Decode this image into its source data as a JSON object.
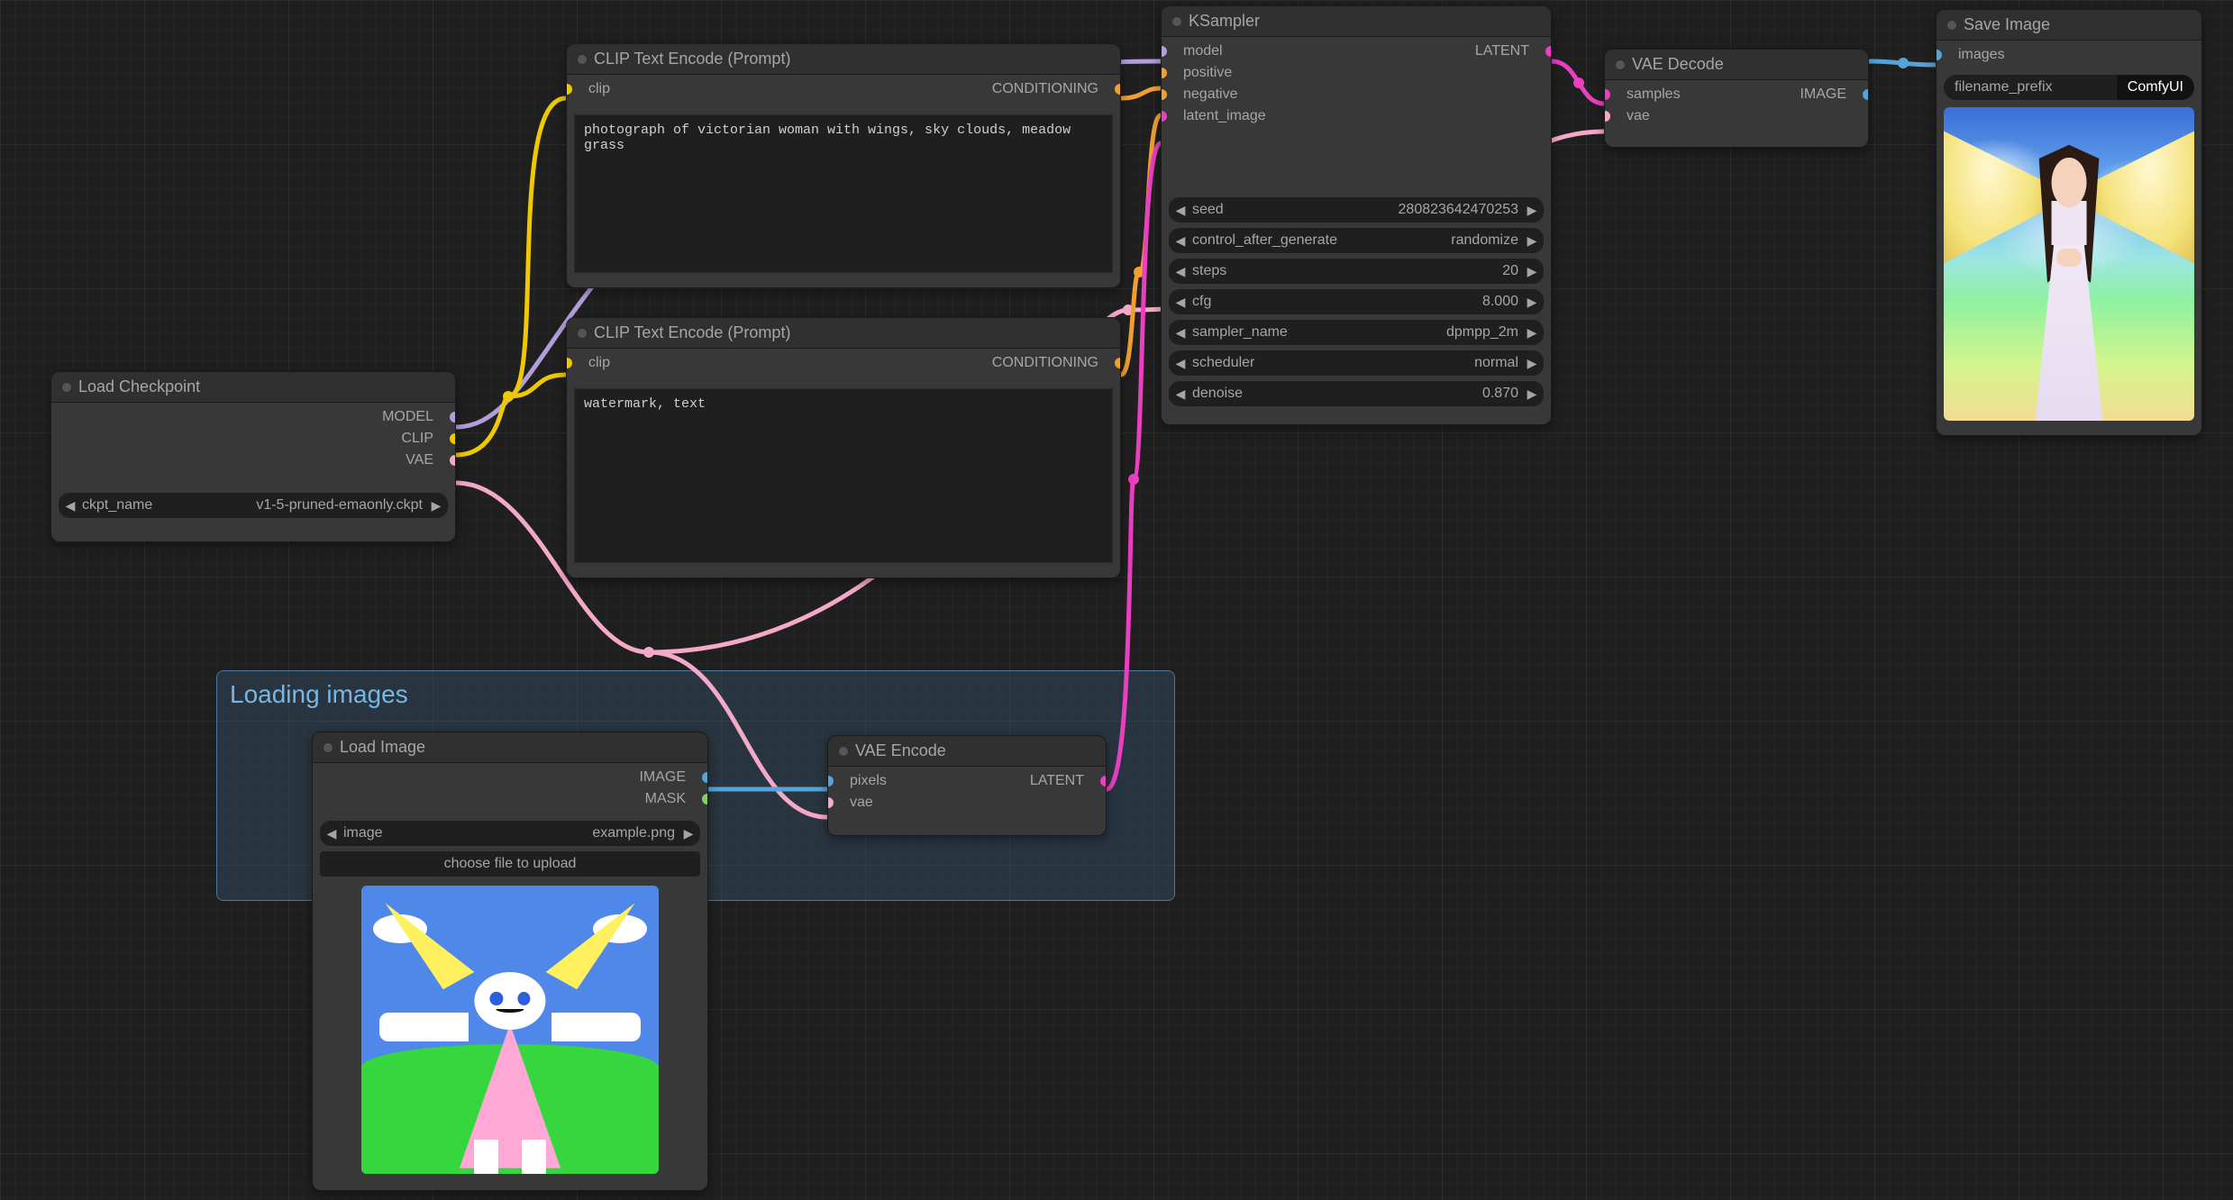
{
  "group": {
    "title": "Loading images"
  },
  "nodes": {
    "load_checkpoint": {
      "title": "Load Checkpoint",
      "outputs": [
        "MODEL",
        "CLIP",
        "VAE"
      ],
      "params": {
        "ckpt_name": {
          "label": "ckpt_name",
          "value": "v1-5-pruned-emaonly.ckpt"
        }
      }
    },
    "clip_pos": {
      "title": "CLIP Text Encode (Prompt)",
      "inputs": [
        "clip"
      ],
      "outputs": [
        "CONDITIONING"
      ],
      "text": "photograph of victorian woman with wings, sky clouds, meadow grass"
    },
    "clip_neg": {
      "title": "CLIP Text Encode (Prompt)",
      "inputs": [
        "clip"
      ],
      "outputs": [
        "CONDITIONING"
      ],
      "text": "watermark, text"
    },
    "load_image": {
      "title": "Load Image",
      "outputs": [
        "IMAGE",
        "MASK"
      ],
      "params": {
        "image": {
          "label": "image",
          "value": "example.png"
        }
      },
      "upload_label": "choose file to upload"
    },
    "vae_encode": {
      "title": "VAE Encode",
      "inputs": [
        "pixels",
        "vae"
      ],
      "outputs": [
        "LATENT"
      ]
    },
    "ksampler": {
      "title": "KSampler",
      "inputs": [
        "model",
        "positive",
        "negative",
        "latent_image"
      ],
      "outputs": [
        "LATENT"
      ],
      "params": {
        "seed": {
          "label": "seed",
          "value": "280823642470253"
        },
        "control": {
          "label": "control_after_generate",
          "value": "randomize"
        },
        "steps": {
          "label": "steps",
          "value": "20"
        },
        "cfg": {
          "label": "cfg",
          "value": "8.000"
        },
        "sampler_name": {
          "label": "sampler_name",
          "value": "dpmpp_2m"
        },
        "scheduler": {
          "label": "scheduler",
          "value": "normal"
        },
        "denoise": {
          "label": "denoise",
          "value": "0.870"
        }
      }
    },
    "vae_decode": {
      "title": "VAE Decode",
      "inputs": [
        "samples",
        "vae"
      ],
      "outputs": [
        "IMAGE"
      ]
    },
    "save_image": {
      "title": "Save Image",
      "inputs": [
        "images"
      ],
      "params": {
        "filename_prefix": {
          "label": "filename_prefix",
          "value": "ComfyUI"
        }
      }
    }
  }
}
